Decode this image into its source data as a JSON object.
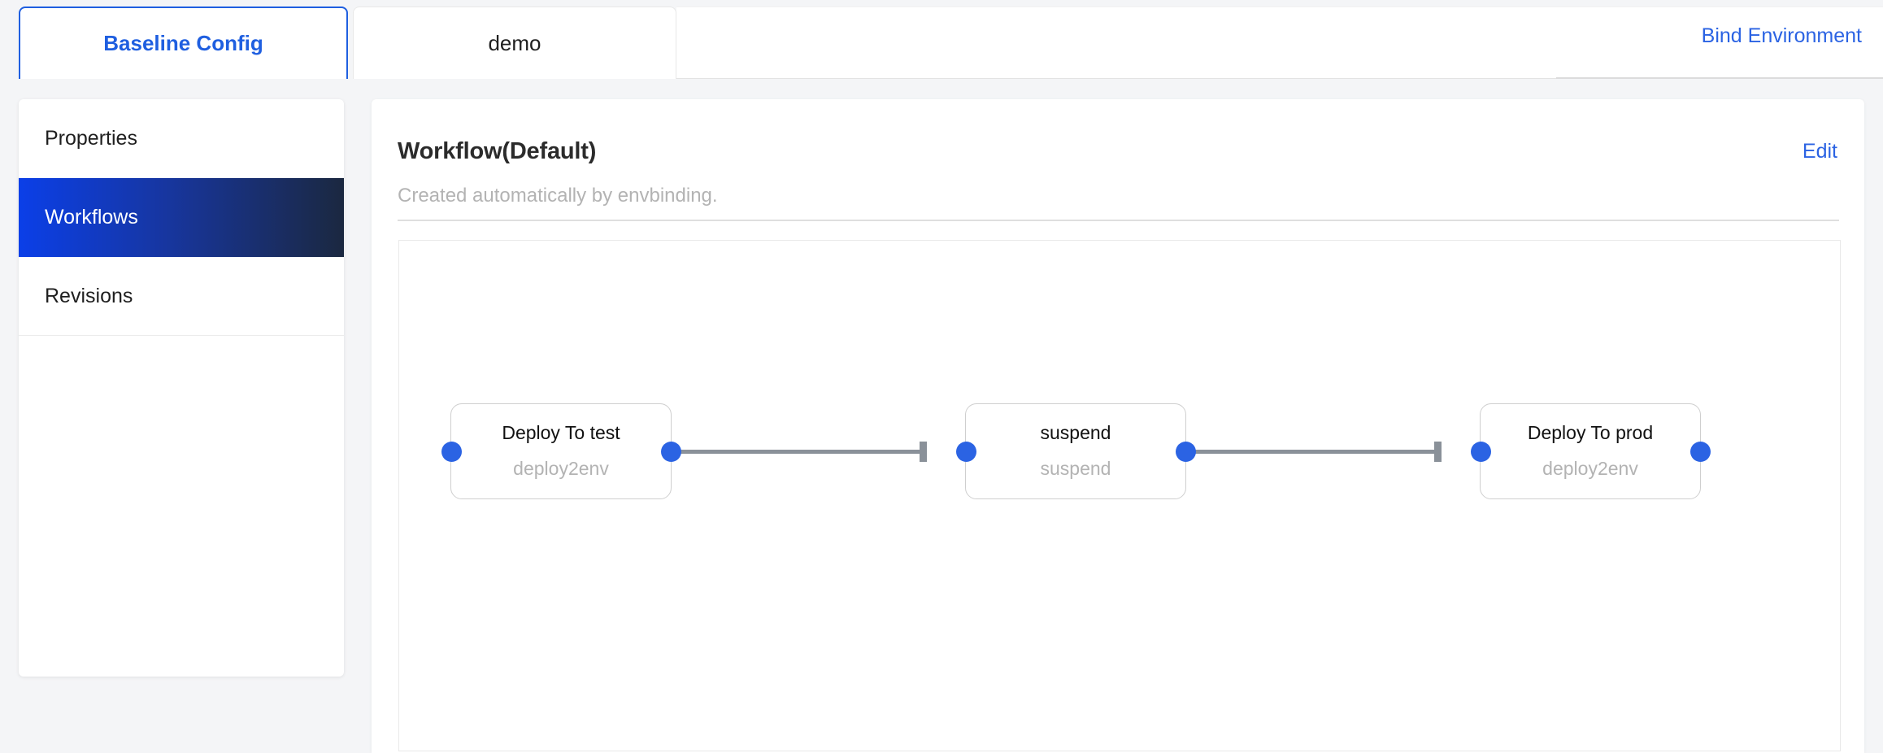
{
  "tabs": [
    {
      "label": "Baseline Config",
      "active": true
    },
    {
      "label": "demo",
      "active": false
    }
  ],
  "header": {
    "bind_environment_label": "Bind Environment"
  },
  "sidebar": {
    "items": [
      {
        "label": "Properties",
        "active": false
      },
      {
        "label": "Workflows",
        "active": true
      },
      {
        "label": "Revisions",
        "active": false
      }
    ]
  },
  "main": {
    "title": "Workflow(Default)",
    "subtitle": "Created automatically by envbinding.",
    "edit_label": "Edit"
  },
  "workflow": {
    "nodes": [
      {
        "title": "Deploy To test",
        "subtitle": "deploy2env"
      },
      {
        "title": "suspend",
        "subtitle": "suspend"
      },
      {
        "title": "Deploy To prod",
        "subtitle": "deploy2env"
      }
    ]
  },
  "colors": {
    "accent_blue": "#2b63e3",
    "active_nav_start": "#0b3fe8",
    "active_nav_end": "#1b2840",
    "edge_gray": "#8a9199",
    "node_border": "#cfcfcf",
    "muted_text": "#b3b3b3"
  }
}
